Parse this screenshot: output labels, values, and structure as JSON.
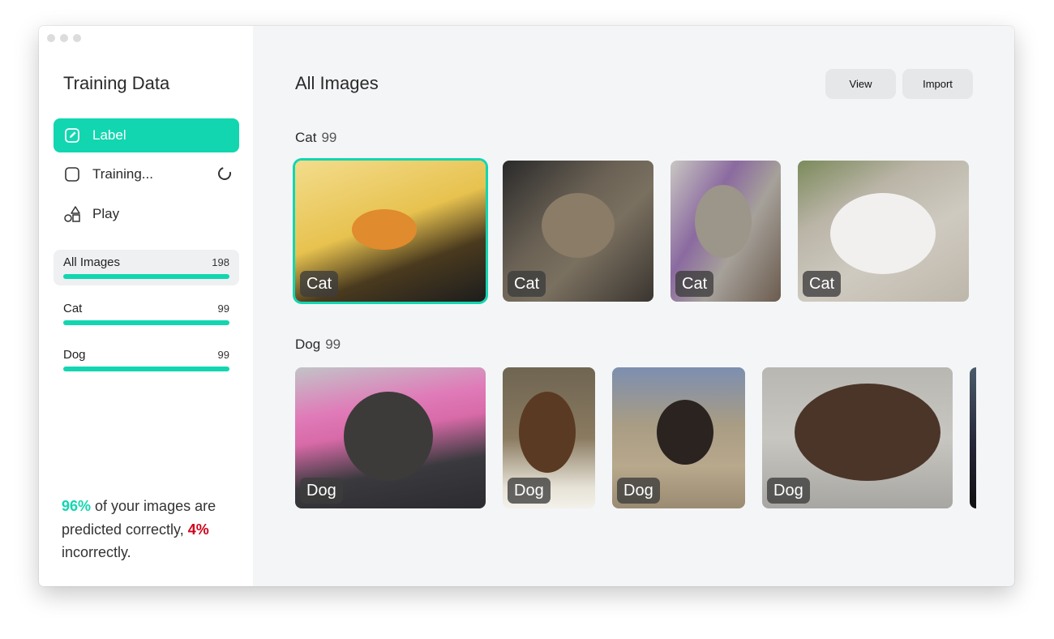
{
  "sidebar": {
    "title": "Training Data",
    "nav": [
      {
        "label": "Label",
        "icon": "edit-icon"
      },
      {
        "label": "Training...",
        "icon": "square-icon"
      },
      {
        "label": "Play",
        "icon": "shapes-icon"
      }
    ],
    "categories": [
      {
        "name": "All Images",
        "count": "198"
      },
      {
        "name": "Cat",
        "count": "99"
      },
      {
        "name": "Dog",
        "count": "99"
      }
    ],
    "stats": {
      "correct_pct": "96%",
      "correct_text": " of your images are predicted correctly,",
      "incorrect_pct": "4%",
      "incorrect_text": " incorrectly."
    }
  },
  "main": {
    "title": "All Images",
    "view_label": "View",
    "import_label": "Import",
    "sections": [
      {
        "name": "Cat",
        "count": "99",
        "thumb_label": "Cat"
      },
      {
        "name": "Dog",
        "count": "99",
        "thumb_label": "Dog"
      }
    ]
  },
  "colors": {
    "accent": "#12d6b0",
    "incorrect": "#d0021b"
  }
}
